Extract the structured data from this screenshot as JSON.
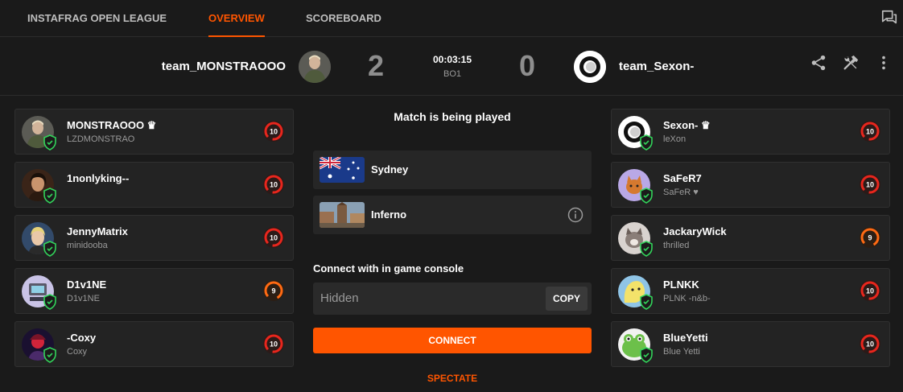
{
  "nav": {
    "tabs": [
      {
        "label": "INSTAFRAG OPEN LEAGUE",
        "active": false
      },
      {
        "label": "OVERVIEW",
        "active": true
      },
      {
        "label": "SCOREBOARD",
        "active": false
      }
    ],
    "chat_icon": "chat-icon"
  },
  "match": {
    "team1": {
      "name": "team_MONSTRAOOO",
      "score": "2"
    },
    "team2": {
      "name": "team_Sexon-",
      "score": "0"
    },
    "timer": "00:03:15",
    "format": "BO1",
    "actions": [
      "share-icon",
      "tools-icon",
      "more-vertical-icon"
    ]
  },
  "roster_left": [
    {
      "name": "MONSTRAOOO",
      "captain": true,
      "sub": "LZDMONSTRAO",
      "level": "10"
    },
    {
      "name": "1nonlyking--",
      "captain": false,
      "sub": "",
      "level": "10"
    },
    {
      "name": "JennyMatrix",
      "captain": false,
      "sub": "minidooba",
      "level": "10"
    },
    {
      "name": "D1v1NE",
      "captain": false,
      "sub": "D1v1NE",
      "level": "9"
    },
    {
      "name": "-Coxy",
      "captain": false,
      "sub": "Coxy",
      "level": "10"
    }
  ],
  "roster_right": [
    {
      "name": "Sexon-",
      "captain": true,
      "sub": "leXon",
      "level": "10"
    },
    {
      "name": "SaFeR7",
      "captain": false,
      "sub": "SaFeR ♥",
      "level": "10"
    },
    {
      "name": "JackaryWick",
      "captain": false,
      "sub": "thrilled",
      "level": "9"
    },
    {
      "name": "PLNKK",
      "captain": false,
      "sub": "PLNK -n&b-",
      "level": "10"
    },
    {
      "name": "BlueYetti",
      "captain": false,
      "sub": "Blue Yetti",
      "level": "10"
    }
  ],
  "center": {
    "status": "Match is being played",
    "location": "Sydney",
    "map": "Inferno",
    "console_title": "Connect with in game console",
    "console_value": "Hidden",
    "copy_label": "COPY",
    "connect_label": "CONNECT",
    "spectate_label": "SPECTATE"
  },
  "colors": {
    "accent": "#ff5500",
    "level10": "#e8261d",
    "level9": "#ff6a13",
    "shield": "#32d35a"
  }
}
